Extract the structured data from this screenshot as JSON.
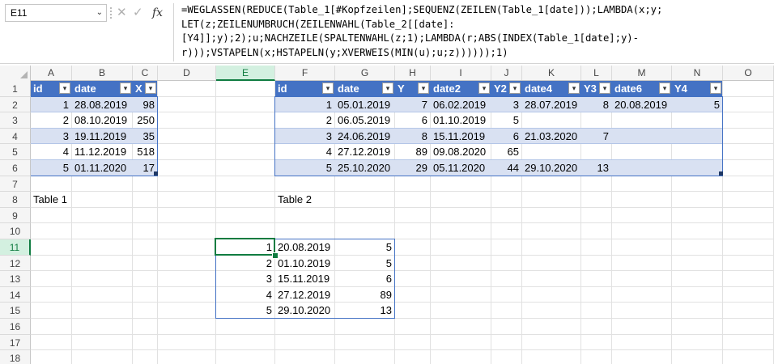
{
  "formula_bar": {
    "name_box": "E11",
    "cancel_icon": "✕",
    "enter_icon": "✓",
    "fx_label": "fx",
    "formula_lines": [
      "=WEGLASSEN(REDUCE(Table_1[#Kopfzeilen];SEQUENZ(ZEILEN(Table_1[date]));LAMBDA(x;y;",
      "LET(z;ZEILENUMBRUCH(ZEILENWAHL(Table_2[[date]:",
      "[Y4]];y);2);u;NACHZEILE(SPALTENWAHL(z;1);LAMBDA(r;ABS(INDEX(Table_1[date];y)-",
      "r)));VSTAPELN(x;HSTAPELN(y;XVERWEIS(MIN(u);u;z))))));1)"
    ]
  },
  "columns": [
    "A",
    "B",
    "C",
    "D",
    "E",
    "F",
    "G",
    "H",
    "I",
    "J",
    "K",
    "L",
    "M",
    "N",
    "O"
  ],
  "selected_column": "E",
  "rows": [
    "1",
    "2",
    "3",
    "4",
    "5",
    "6",
    "7",
    "8",
    "9",
    "10",
    "11",
    "12",
    "13",
    "14",
    "15",
    "16",
    "17",
    "18"
  ],
  "selected_row": "11",
  "table1": {
    "headers": [
      "id",
      "date",
      "X"
    ],
    "rows": [
      [
        "1",
        "28.08.2019",
        "98"
      ],
      [
        "2",
        "08.10.2019",
        "250"
      ],
      [
        "3",
        "19.11.2019",
        "35"
      ],
      [
        "4",
        "11.12.2019",
        "518"
      ],
      [
        "5",
        "01.11.2020",
        "17"
      ]
    ],
    "caption": "Table 1"
  },
  "table2": {
    "headers": [
      "id",
      "date",
      "Y",
      "date2",
      "Y2",
      "date4",
      "Y3",
      "date6",
      "Y4"
    ],
    "rows": [
      [
        "1",
        "05.01.2019",
        "7",
        "06.02.2019",
        "3",
        "28.07.2019",
        "8",
        "20.08.2019",
        "5"
      ],
      [
        "2",
        "06.05.2019",
        "6",
        "01.10.2019",
        "5",
        "",
        "",
        "",
        ""
      ],
      [
        "3",
        "24.06.2019",
        "8",
        "15.11.2019",
        "6",
        "21.03.2020",
        "7",
        "",
        ""
      ],
      [
        "4",
        "27.12.2019",
        "89",
        "09.08.2020",
        "65",
        "",
        "",
        "",
        ""
      ],
      [
        "5",
        "25.10.2020",
        "29",
        "05.11.2020",
        "44",
        "29.10.2020",
        "13",
        "",
        ""
      ]
    ],
    "caption": "Table 2"
  },
  "result": {
    "rows": [
      [
        "1",
        "20.08.2019",
        "5"
      ],
      [
        "2",
        "01.10.2019",
        "5"
      ],
      [
        "3",
        "15.11.2019",
        "6"
      ],
      [
        "4",
        "27.12.2019",
        "89"
      ],
      [
        "5",
        "29.10.2020",
        "13"
      ]
    ]
  },
  "colors": {
    "table_header": "#4472c4",
    "band": "#d9e1f2",
    "selection": "#107c41"
  },
  "icons": {
    "filter": "filter-dropdown-icon",
    "namebox_dropdown": "chevron-down-icon"
  }
}
